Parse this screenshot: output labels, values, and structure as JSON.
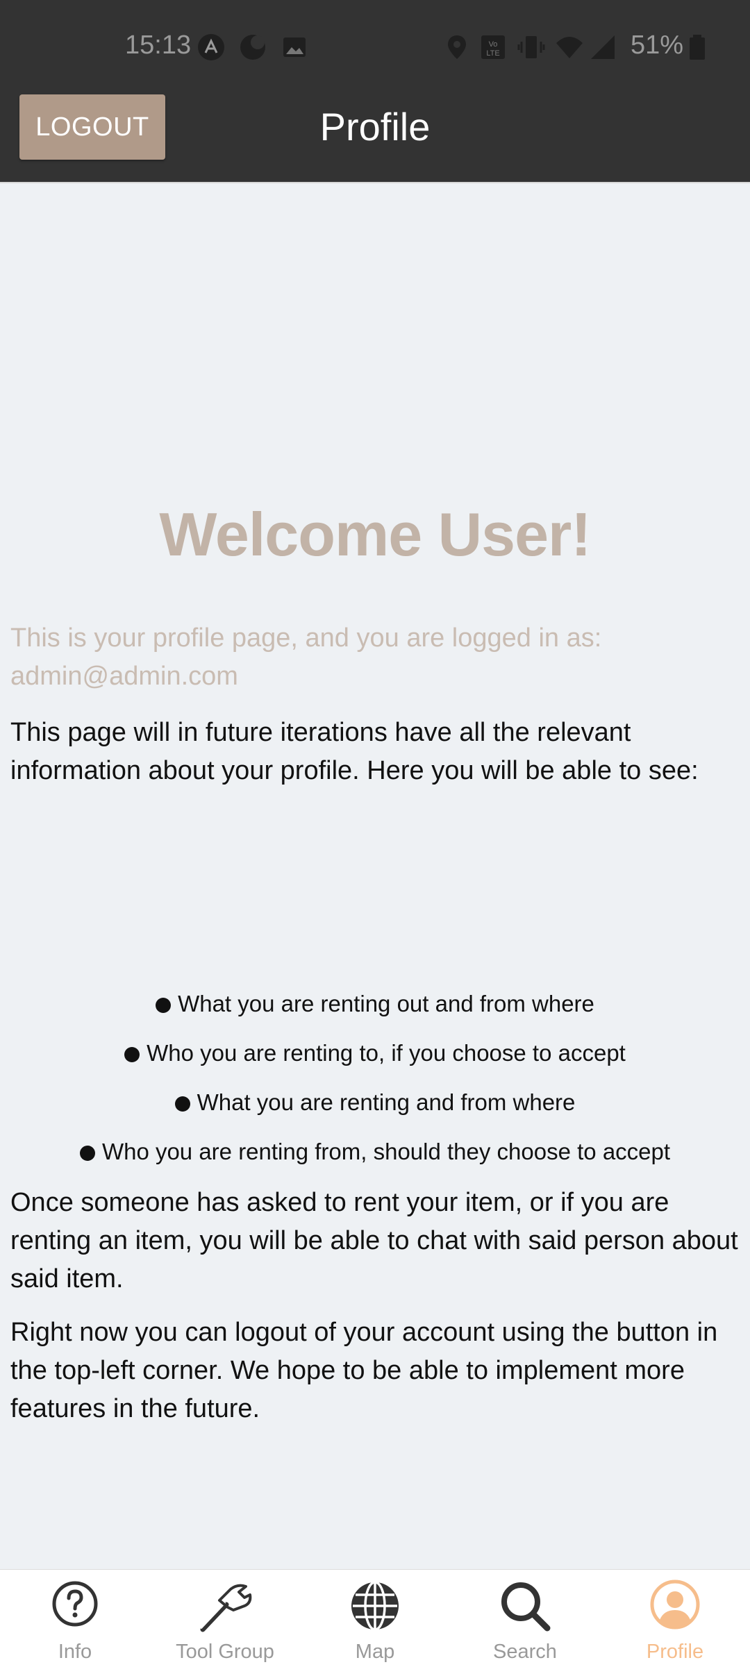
{
  "status_bar": {
    "time": "15:13",
    "battery": "51%",
    "icons_left": [
      "app-icon",
      "moon-icon",
      "image-icon"
    ],
    "icons_right": [
      "location-icon",
      "volte-icon",
      "vibrate-icon",
      "wifi-icon",
      "signal-icon",
      "battery-icon"
    ]
  },
  "app_bar": {
    "logout_label": "LOGOUT",
    "title": "Profile"
  },
  "main": {
    "welcome": "Welcome User!",
    "logged_in_text": "This is your profile page, and you are logged in as: admin@admin.com",
    "intro": "This page will in future iterations have all the relevant information about your profile. Here you will be able to see:",
    "bullets": [
      "What you are renting out and from where",
      "Who you are renting to, if you choose to accept",
      "What you are renting and from where",
      "Who you are renting from, should they choose to accept"
    ],
    "chat_text": "Once someone has asked to rent your item, or if you are renting an item, you will be able to chat with said person about said item.",
    "logout_text": "Right now you can logout of your account using the button in the top-left corner. We hope to be able to implement more features in the future."
  },
  "tabs": [
    {
      "label": "Info",
      "icon": "question-circle-icon"
    },
    {
      "label": "Tool Group",
      "icon": "hammer-icon"
    },
    {
      "label": "Map",
      "icon": "globe-icon"
    },
    {
      "label": "Search",
      "icon": "search-icon"
    },
    {
      "label": "Profile",
      "icon": "user-circle-icon",
      "active": true
    }
  ],
  "colors": {
    "accent": "#b09a89",
    "active_tab": "#f6bd8b",
    "header": "#333333",
    "background": "#eef1f4"
  }
}
